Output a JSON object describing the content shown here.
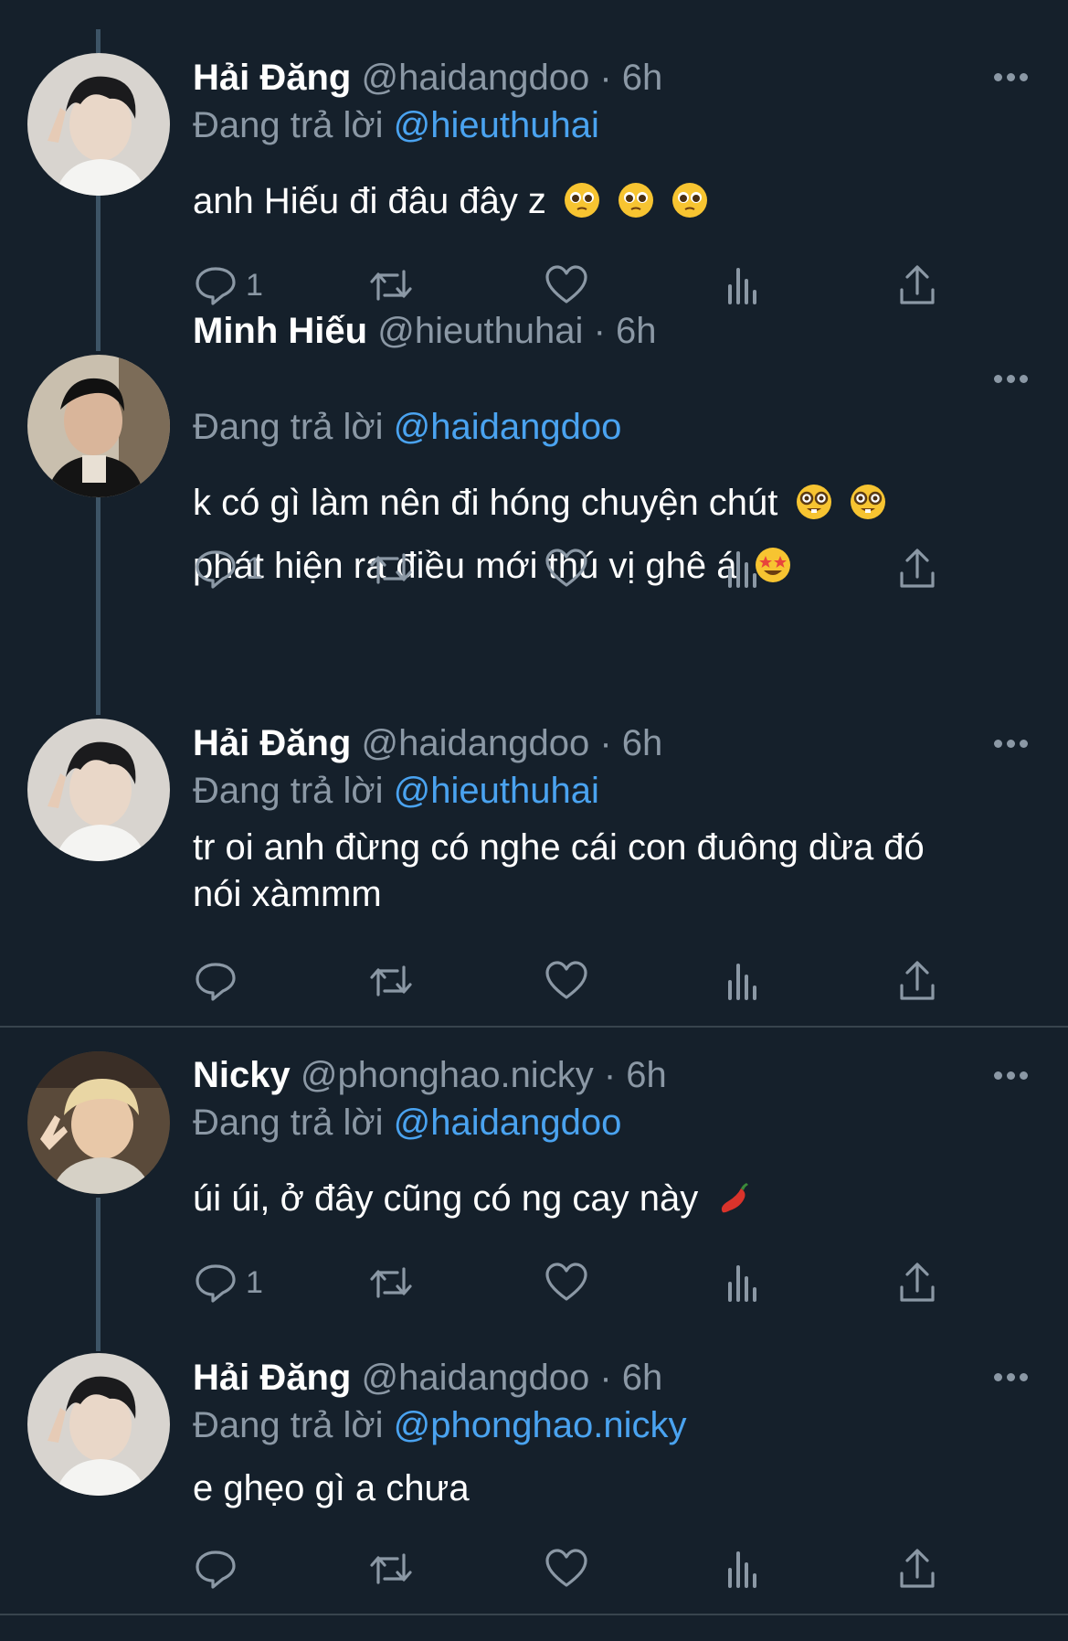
{
  "tweets": [
    {
      "name": "Hải Đăng",
      "handle": "@haidangdoo",
      "time": "· 6h",
      "reply_prefix": "Đang trả lời",
      "reply_to": "@hieuthuhai",
      "lines": [
        "anh Hiếu đi đâu đây z"
      ],
      "emojis": [
        "pleading-face",
        "pleading-face",
        "pleading-face"
      ],
      "reply_count": "1"
    },
    {
      "name": "Minh Hiếu",
      "handle": "@hieuthuhai",
      "time": "· 6h",
      "reply_prefix": "Đang trả lời",
      "reply_to": "@haidangdoo",
      "lines": [
        "k có gì làm nên đi hóng chuyện chút",
        "phát hiện ra điều mới thú vị ghê á"
      ],
      "reply_count": "1"
    },
    {
      "name": "Hải Đăng",
      "handle": "@haidangdoo",
      "time": "· 6h",
      "reply_prefix": "Đang trả lời",
      "reply_to": "@hieuthuhai",
      "lines": [
        "tr oi anh đừng có nghe cái con đuông dừa đó",
        "nói xàmmm"
      ],
      "reply_count": ""
    },
    {
      "name": "Nicky",
      "handle": "@phonghao.nicky",
      "time": "· 6h",
      "reply_prefix": "Đang trả lời",
      "reply_to": "@haidangdoo",
      "lines": [
        "úi úi, ở đây cũng có ng cay này"
      ],
      "reply_count": "1"
    },
    {
      "name": "Hải Đăng",
      "handle": "@haidangdoo",
      "time": "· 6h",
      "reply_prefix": "Đang trả lời",
      "reply_to": "@phonghao.nicky",
      "lines": [
        "e ghẹo gì a chưa"
      ],
      "reply_count": ""
    }
  ],
  "icons": {
    "reply": "comment-icon",
    "retweet": "retweet-icon",
    "like": "heart-icon",
    "views": "bar-chart-icon",
    "share": "share-icon",
    "more": "more-dots-icon"
  },
  "colors": {
    "background": "#15202b",
    "secondary_text": "#8b98a5",
    "link": "#4aa3f0",
    "thread_line": "#3d5466"
  }
}
